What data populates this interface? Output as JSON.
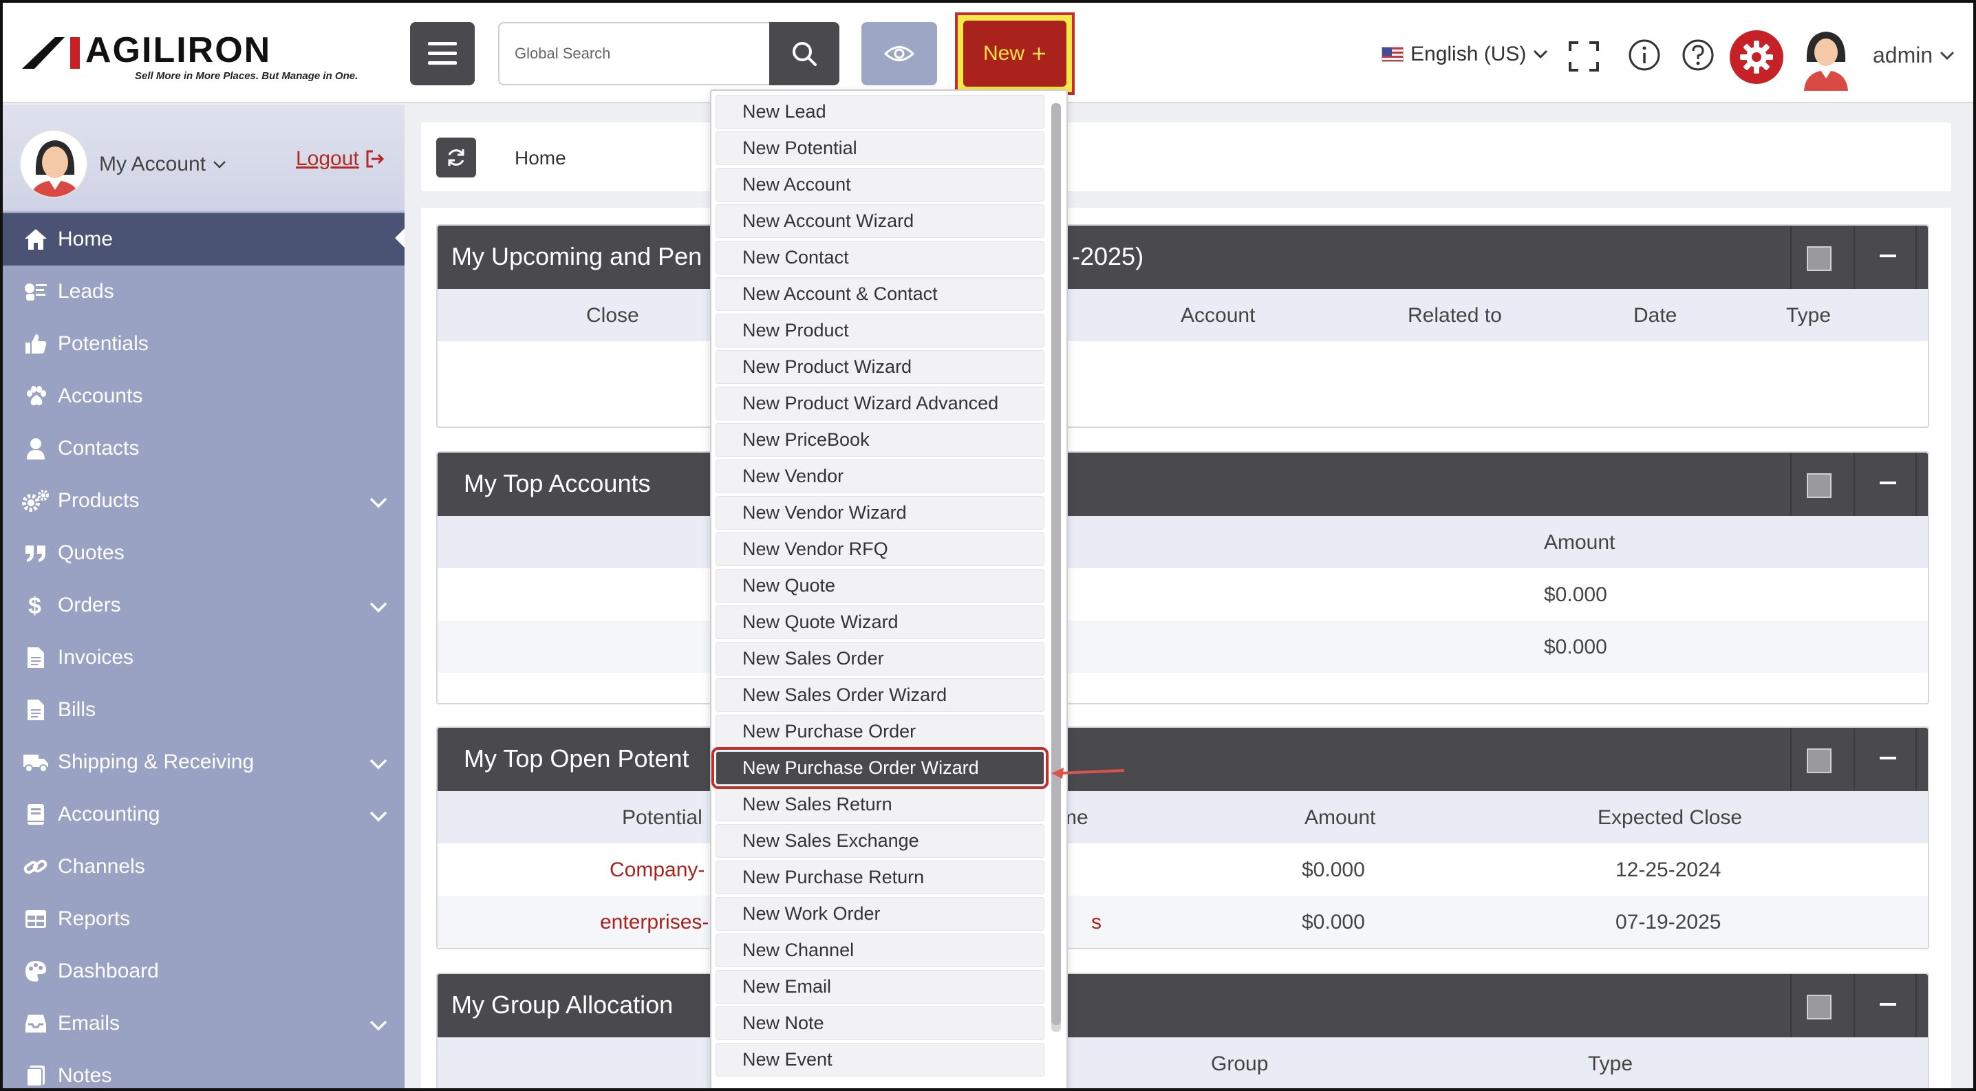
{
  "header": {
    "logo_text": "AGILIRON",
    "tagline": "Sell More in More Places. But Manage in One.",
    "search_placeholder": "Global Search",
    "new_button_label": "New",
    "language": "English (US)",
    "user_name": "admin"
  },
  "sidebar": {
    "account_label": "My Account",
    "logout_label": "Logout",
    "items": [
      {
        "label": "Home",
        "icon": "home-icon",
        "active": true,
        "expandable": false
      },
      {
        "label": "Leads",
        "icon": "leads-icon",
        "active": false,
        "expandable": false
      },
      {
        "label": "Potentials",
        "icon": "thumbs-up-icon",
        "active": false,
        "expandable": false
      },
      {
        "label": "Accounts",
        "icon": "paw-icon",
        "active": false,
        "expandable": false
      },
      {
        "label": "Contacts",
        "icon": "person-icon",
        "active": false,
        "expandable": false
      },
      {
        "label": "Products",
        "icon": "gears-icon",
        "active": false,
        "expandable": true
      },
      {
        "label": "Quotes",
        "icon": "quote-icon",
        "active": false,
        "expandable": false
      },
      {
        "label": "Orders",
        "icon": "dollar-icon",
        "active": false,
        "expandable": true
      },
      {
        "label": "Invoices",
        "icon": "document-icon",
        "active": false,
        "expandable": false
      },
      {
        "label": "Bills",
        "icon": "document-icon",
        "active": false,
        "expandable": false
      },
      {
        "label": "Shipping & Receiving",
        "icon": "truck-icon",
        "active": false,
        "expandable": true
      },
      {
        "label": "Accounting",
        "icon": "book-icon",
        "active": false,
        "expandable": true
      },
      {
        "label": "Channels",
        "icon": "link-icon",
        "active": false,
        "expandable": false
      },
      {
        "label": "Reports",
        "icon": "table-icon",
        "active": false,
        "expandable": false
      },
      {
        "label": "Dashboard",
        "icon": "palette-icon",
        "active": false,
        "expandable": false
      },
      {
        "label": "Emails",
        "icon": "inbox-icon",
        "active": false,
        "expandable": true
      },
      {
        "label": "Notes",
        "icon": "note-icon",
        "active": false,
        "expandable": false
      }
    ]
  },
  "breadcrumb": {
    "current": "Home"
  },
  "panels": {
    "upcoming": {
      "title": "My Upcoming and Pen",
      "title_tail": "-2025)",
      "columns": [
        "Close",
        "Account",
        "Related to",
        "Date",
        "Type"
      ]
    },
    "top_accounts": {
      "title": "My Top Accounts",
      "columns": [
        "Amount"
      ],
      "rows": [
        [
          "$0.000"
        ],
        [
          "$0.000"
        ]
      ]
    },
    "top_potentials": {
      "title": "My Top Open Potent",
      "columns": [
        "Potential",
        "me",
        "Amount",
        "Expected Close"
      ],
      "rows": [
        [
          "Company-",
          "",
          "$0.000",
          "12-25-2024"
        ],
        [
          "enterprises-",
          "s",
          "$0.000",
          "07-19-2025"
        ]
      ]
    },
    "group_allocation": {
      "title": "My Group Allocation",
      "columns": [
        "Group",
        "Type"
      ]
    }
  },
  "dropdown": {
    "selected": "New Purchase Order Wizard",
    "items": [
      "New Lead",
      "New Potential",
      "New Account",
      "New Account Wizard",
      "New Contact",
      "New Account & Contact",
      "New Product",
      "New Product Wizard",
      "New Product Wizard Advanced",
      "New PriceBook",
      "New Vendor",
      "New Vendor Wizard",
      "New Vendor RFQ",
      "New Quote",
      "New Quote Wizard",
      "New Sales Order",
      "New Sales Order Wizard",
      "New Purchase Order",
      "New Purchase Order Wizard",
      "New Sales Return",
      "New Sales Exchange",
      "New Purchase Return",
      "New Work Order",
      "New Channel",
      "New Email",
      "New Note",
      "New Event"
    ]
  },
  "colors": {
    "brand_red": "#a9231c",
    "dark_gray": "#4a4a4e",
    "sidebar": "#9aa2c3",
    "highlight_yellow": "#f4e84b"
  }
}
